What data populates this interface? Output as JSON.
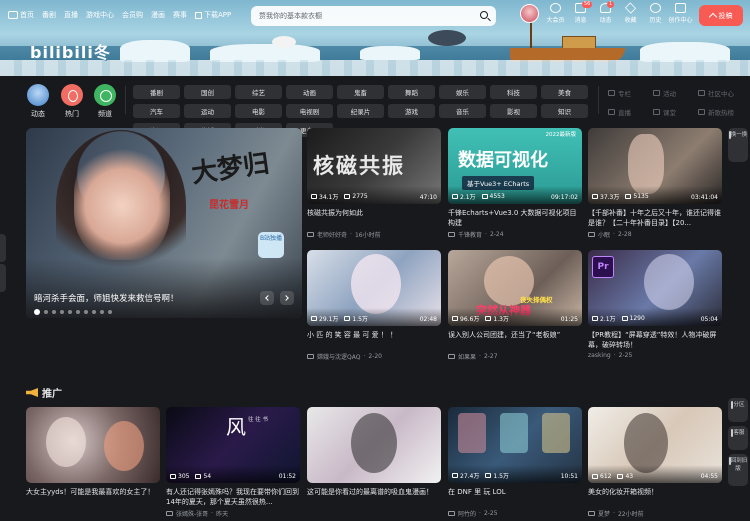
{
  "nav": {
    "items": [
      "首页",
      "番剧",
      "直播",
      "游戏中心",
      "会员购",
      "漫画",
      "赛事"
    ],
    "download_label": "下载APP"
  },
  "search": {
    "placeholder": "赘我你的基本款衣橱"
  },
  "top_right": {
    "items": [
      {
        "label": "大会员",
        "icon": "vip-icon",
        "badge": ""
      },
      {
        "label": "消息",
        "icon": "message-icon",
        "badge": "56"
      },
      {
        "label": "动态",
        "icon": "dynamic-icon",
        "badge": "1"
      },
      {
        "label": "收藏",
        "icon": "favorite-icon",
        "badge": ""
      },
      {
        "label": "历史",
        "icon": "history-icon",
        "badge": ""
      },
      {
        "label": "创作中心",
        "icon": "creator-icon",
        "badge": ""
      }
    ],
    "upload_label": "投稿"
  },
  "banner": {
    "brand": "bilibili冬"
  },
  "channels": {
    "big": [
      {
        "label": "动态",
        "icon": "avatar-icon"
      },
      {
        "label": "热门",
        "icon": "fire-icon"
      },
      {
        "label": "频道",
        "icon": "channel-icon"
      }
    ],
    "pills": [
      "番剧",
      "国创",
      "综艺",
      "动画",
      "鬼畜",
      "舞蹈",
      "娱乐",
      "科技",
      "美食",
      "汽车",
      "运动",
      "电影",
      "电视剧",
      "纪录片",
      "游戏",
      "音乐",
      "影视",
      "知识",
      "资讯",
      "生活",
      "时尚",
      "更多"
    ],
    "links": [
      {
        "label": "专栏",
        "icon": "column-icon"
      },
      {
        "label": "活动",
        "icon": "activity-icon"
      },
      {
        "label": "社区中心",
        "icon": "community-icon"
      },
      {
        "label": "直播",
        "icon": "live-icon"
      },
      {
        "label": "课堂",
        "icon": "classroom-icon"
      },
      {
        "label": "新歌热榜",
        "icon": "music-chart-icon"
      }
    ]
  },
  "carousel": {
    "title": "暗河杀手会面，师姐快发来救信号啊！",
    "calligraphy": "大梦归",
    "subtitle": "昆花雪月",
    "tag": "B站独播",
    "slides": 10
  },
  "videos": [
    {
      "title": "核磁共振为何如此",
      "views": "34.1万",
      "danmaku": "2775",
      "duration": "47:10",
      "author": "老师好好奇",
      "date": "16小时前",
      "thumb_text": "核磁共振"
    },
    {
      "title": "千锋Echarts+Vue3.0 大数据可视化项目构建",
      "views": "2.1万",
      "danmaku": "4553",
      "duration": "09:17:02",
      "author": "千锋教育",
      "date": "2-24",
      "thumb_text": "数据可视化",
      "thumb_sub": "基于Vue3+ ECharts",
      "thumb_top": "2022最新版"
    },
    {
      "title": "【千部补番】十年之后又十年，谁还记得谁是谁？【二十年补番目录】【20...",
      "views": "37.3万",
      "danmaku": "5135",
      "duration": "03:41:04",
      "author": "小眠",
      "date": "2-28"
    },
    {
      "title": "小 匹 的 笑 容 最 可 爱 ！ ！",
      "views": "29.1万",
      "danmaku": "1.5万",
      "duration": "02:48",
      "author": "嫦娥与沈逻QAQ",
      "date": "2-20"
    },
    {
      "title": "误入别人公司团建，还当了“老板娘”",
      "views": "96.6万",
      "danmaku": "1.3万",
      "duration": "01:25",
      "author": "如果果",
      "date": "2-27",
      "thumb_top": "丧失择偶权",
      "thumb_text": "突然从神器"
    },
    {
      "title": "【PR教程】“屏幕穿透”特效！人物冲破屏幕，破碎转场！",
      "views": "2.1万",
      "danmaku": "1290",
      "duration": "05:04",
      "author": "zasking",
      "date": "2-25",
      "thumb_text": "Pr"
    }
  ],
  "promo": {
    "title": "推广",
    "videos": [
      {
        "title": "大女主yyds！可能是我最喜欢的女主了！",
        "views": "",
        "danmaku": "",
        "duration": "",
        "author": "",
        "date": ""
      },
      {
        "title": "有人还记得张嫣殊吗？我现在要带你们回到14年的夏天，那个夏天虽然很热...",
        "views": "305",
        "danmaku": "54",
        "duration": "01:52",
        "author": "张嫣殊-张哥",
        "date": "昨天",
        "thumb_text": "风",
        "thumb_sub": "往 往 书"
      },
      {
        "title": "这可能是你看过的最离谱的吸血鬼漫画！",
        "views": "",
        "danmaku": "",
        "duration": "",
        "author": "",
        "date": ""
      },
      {
        "title": "在 DNF 里 玩 LOL",
        "views": "27.4万",
        "danmaku": "1.5万",
        "duration": "10:51",
        "author": "阿竹的",
        "date": "2-25"
      },
      {
        "title": "美女的化妆开箱视频！",
        "views": "612",
        "danmaku": "43",
        "duration": "04:55",
        "author": "夏梦",
        "date": "22小时前"
      }
    ]
  },
  "sidebar": {
    "switch_label": "换一换",
    "share_label": "分区",
    "service_label": "客服",
    "back_label": "回到旧版"
  }
}
